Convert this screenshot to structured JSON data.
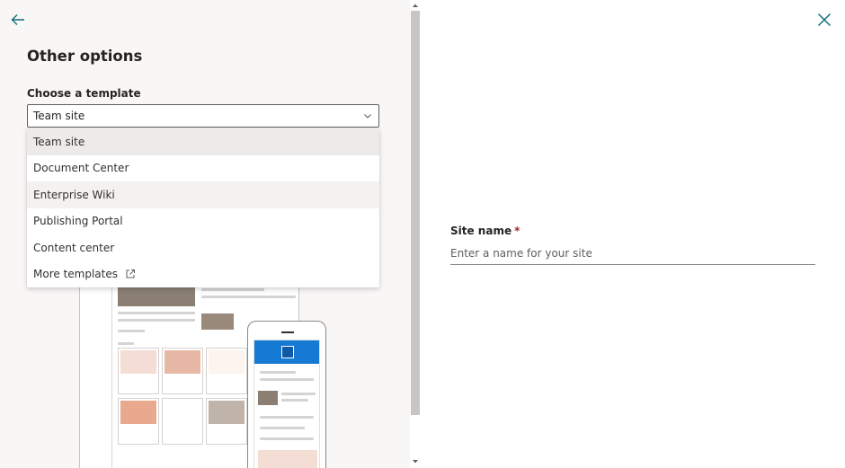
{
  "panel": {
    "title": "Other options",
    "template_label": "Choose a template",
    "selected_template": "Team site",
    "templates": [
      {
        "label": "Team site"
      },
      {
        "label": "Document Center"
      },
      {
        "label": "Enterprise Wiki"
      },
      {
        "label": "Publishing Portal"
      },
      {
        "label": "Content center"
      },
      {
        "label": "More templates"
      }
    ]
  },
  "form": {
    "site_name_label": "Site name",
    "required_marker": "*",
    "site_name_placeholder": "Enter a name for your site",
    "site_name_value": ""
  },
  "icons": {
    "back": "arrow-left-icon",
    "close": "close-icon",
    "chevron": "chevron-down-icon",
    "external": "open-in-new-window-icon"
  },
  "colors": {
    "accent": "#0f6e79",
    "required": "#a4262c",
    "selected_bg": "#edebe9",
    "preview_header": "#1679d3"
  }
}
